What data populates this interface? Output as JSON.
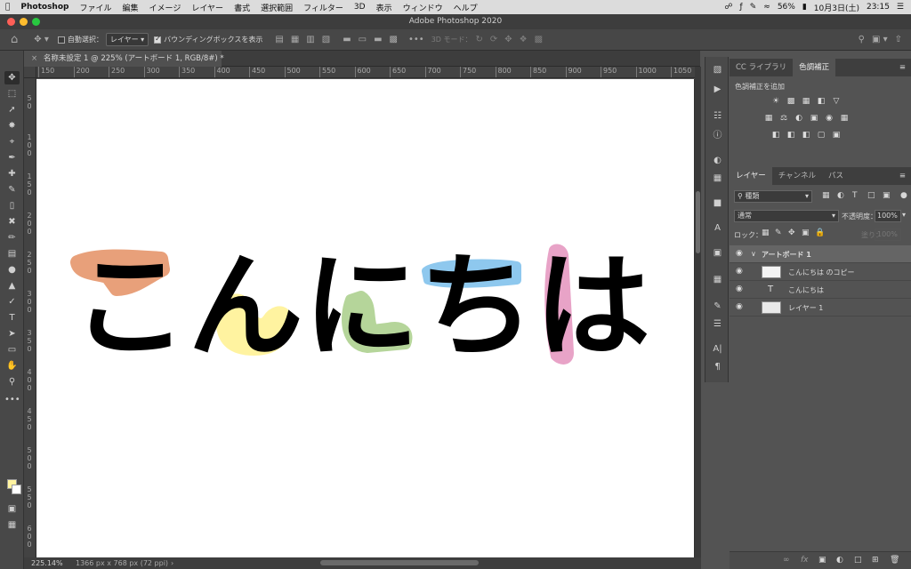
{
  "menubar": {
    "app": "Photoshop",
    "items": [
      "ファイル",
      "編集",
      "イメージ",
      "レイヤー",
      "書式",
      "選択範囲",
      "フィルター",
      "3D",
      "表示",
      "ウィンドウ",
      "ヘルプ"
    ],
    "battery": "56%",
    "date": "10月3日(土)",
    "time": "23:15"
  },
  "window": {
    "title": "Adobe Photoshop 2020"
  },
  "options": {
    "auto_select": "自動選択：",
    "layer_select": "レイヤー",
    "bounding_box": "バウンディングボックスを表示",
    "mode_3d": "3D モード："
  },
  "document": {
    "tab": "名称未設定 1 @ 225% (アートボード 1, RGB/8#) *",
    "zoom": "225.14%",
    "size_info": "1366 px x 768 px (72 ppi)"
  },
  "rulers": {
    "h": [
      "150",
      "200",
      "250",
      "300",
      "350",
      "400",
      "450",
      "500",
      "550",
      "600",
      "650",
      "700",
      "750",
      "800",
      "850",
      "900",
      "950",
      "1000",
      "1050"
    ],
    "v": [
      "50",
      "100",
      "150",
      "200",
      "250",
      "300",
      "350",
      "400",
      "450",
      "500",
      "550",
      "600"
    ]
  },
  "artwork": {
    "text": "こんにちは"
  },
  "adjust_panel": {
    "tabs": [
      "CC ライブラリ",
      "色調補正"
    ],
    "add_label": "色調補正を追加"
  },
  "layers_panel": {
    "tabs": [
      "レイヤー",
      "チャンネル",
      "パス"
    ],
    "filter": "種類",
    "blend": "通常",
    "opacity_label": "不透明度：",
    "opacity": "100%",
    "lock_label": "ロック：",
    "fill_label": "塗り：",
    "fill": "100%",
    "artboard": "アートボード 1",
    "layers": [
      {
        "name": "こんにちは のコピー",
        "kind": "image"
      },
      {
        "name": "こんにちは",
        "kind": "text"
      },
      {
        "name": "レイヤー 1",
        "kind": "image"
      }
    ]
  },
  "colors": {
    "foreground": "#fff3a0",
    "background": "#ffffff"
  }
}
